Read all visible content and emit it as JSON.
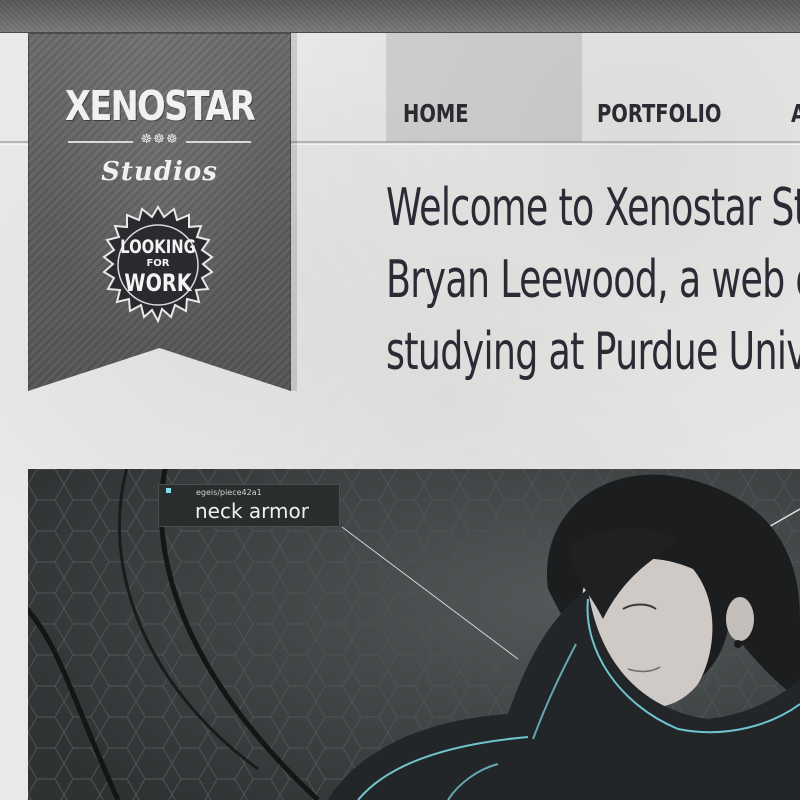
{
  "logo": {
    "brand": "XENOSTAR",
    "ornament": "☸☸☸",
    "sub": "Studios",
    "seal_line1": "LOOKING",
    "seal_line2": "FOR",
    "seal_line3": "WORK"
  },
  "nav": {
    "items": [
      {
        "label": "HOME"
      },
      {
        "label": "PORTFOLIO"
      },
      {
        "label": "A"
      }
    ]
  },
  "welcome": {
    "lines": [
      "Welcome to Xenostar Stu",
      "Bryan Leewood, a web de",
      "studying at Purdue Unive"
    ]
  },
  "hero": {
    "callout_id": "egeis/piece42a1",
    "callout_label": "neck armor",
    "accent_color": "#7fe0ea"
  }
}
